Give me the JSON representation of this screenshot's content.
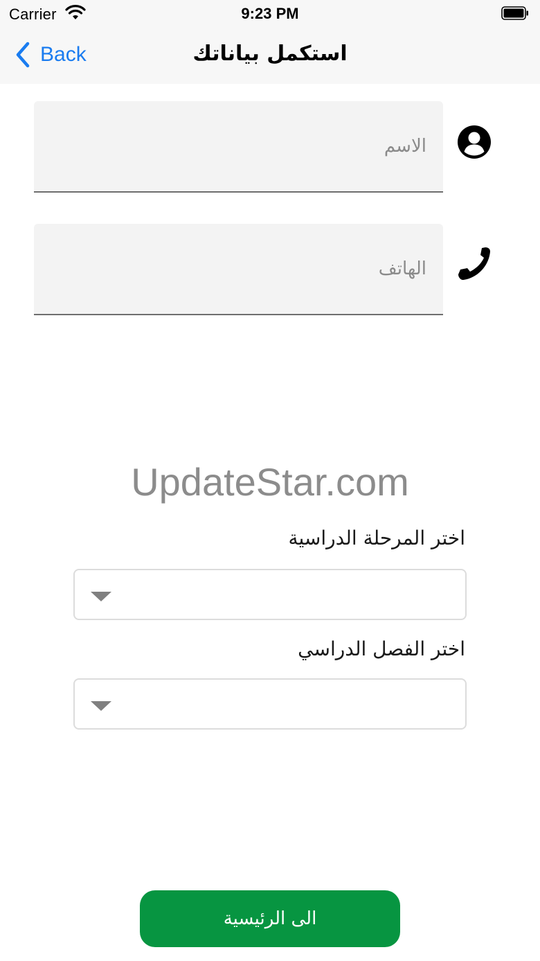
{
  "status_bar": {
    "carrier": "Carrier",
    "time": "9:23 PM",
    "icons": [
      "wifi-icon",
      "battery-icon"
    ]
  },
  "nav": {
    "back_label": "Back",
    "title": "استكمل بياناتك",
    "accent_color": "#1a7cf0"
  },
  "form": {
    "name_field": {
      "placeholder": "الاسم",
      "value": "",
      "icon": "person-icon"
    },
    "phone_field": {
      "placeholder": "الهاتف",
      "value": "",
      "icon": "phone-icon"
    },
    "stage_label": "اختر المرحلة الدراسية",
    "stage_value": "",
    "semester_label": "اختر الفصل الدراسي",
    "semester_value": ""
  },
  "watermark": "UpdateStar.com",
  "home_button": {
    "label": "الى الرئيسية",
    "color": "#079541"
  }
}
